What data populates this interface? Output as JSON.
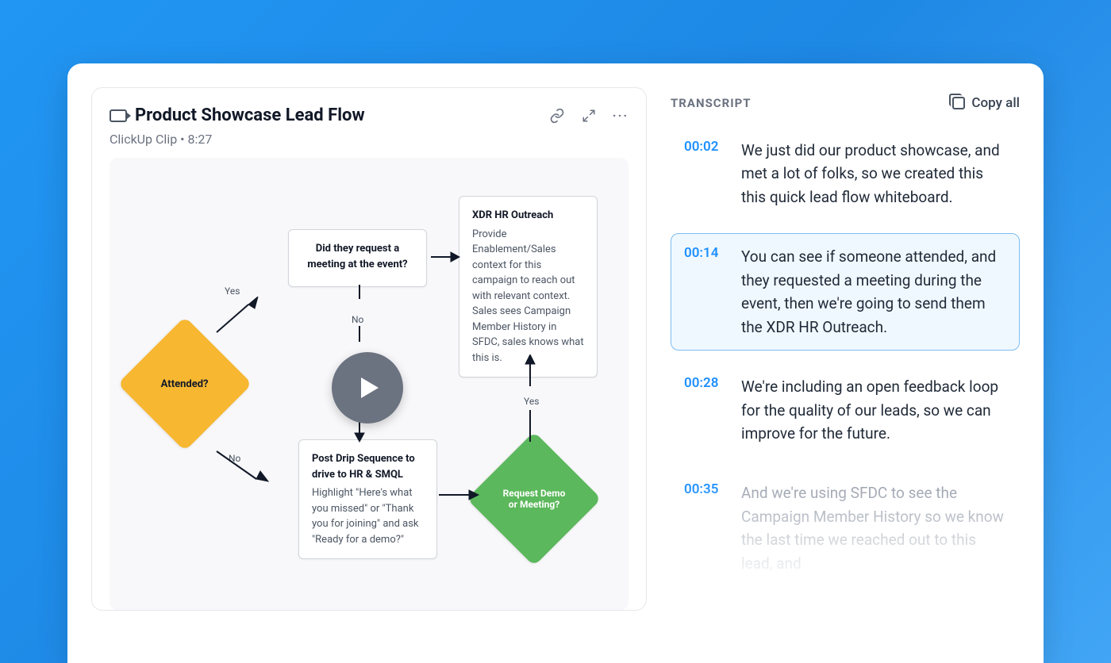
{
  "clip": {
    "title": "Product Showcase Lead Flow",
    "source": "ClickUp Clip",
    "duration": "8:27"
  },
  "flow": {
    "attended": "Attended?",
    "request_meeting": "Request Demo or Meeting?",
    "box1_title": "Did they request a meeting at the event?",
    "box2_title": "XDR HR Outreach",
    "box2_body": "Provide Enablement/Sales context for this campaign to reach out with relevant context. Sales sees Campaign Member History in SFDC, sales knows what this is.",
    "box3_title": "Post Drip Sequence to drive to HR & SMQL",
    "box3_body": "Highlight \"Here's what you missed\" or \"Thank you for joining\" and ask \"Ready for a demo?\"",
    "labels": {
      "yes": "Yes",
      "no": "No"
    }
  },
  "transcript": {
    "title": "TRANSCRIPT",
    "copy_all": "Copy all",
    "entries": [
      {
        "time": "00:02",
        "text": "We just did our product showcase, and met a lot of folks, so we created this this quick lead flow whiteboard.",
        "active": false
      },
      {
        "time": "00:14",
        "text": "You can see if someone attended, and they requested a meeting during the event, then we're going to send them the XDR HR Outreach.",
        "active": true
      },
      {
        "time": "00:28",
        "text": "We're including an open feedback loop for the quality of our leads, so we can improve for the future.",
        "active": false
      },
      {
        "time": "00:35",
        "text": "And we're using SFDC to see the Campaign Member History so we know the last time we reached out to this lead, and",
        "active": false,
        "faded": true
      }
    ]
  }
}
